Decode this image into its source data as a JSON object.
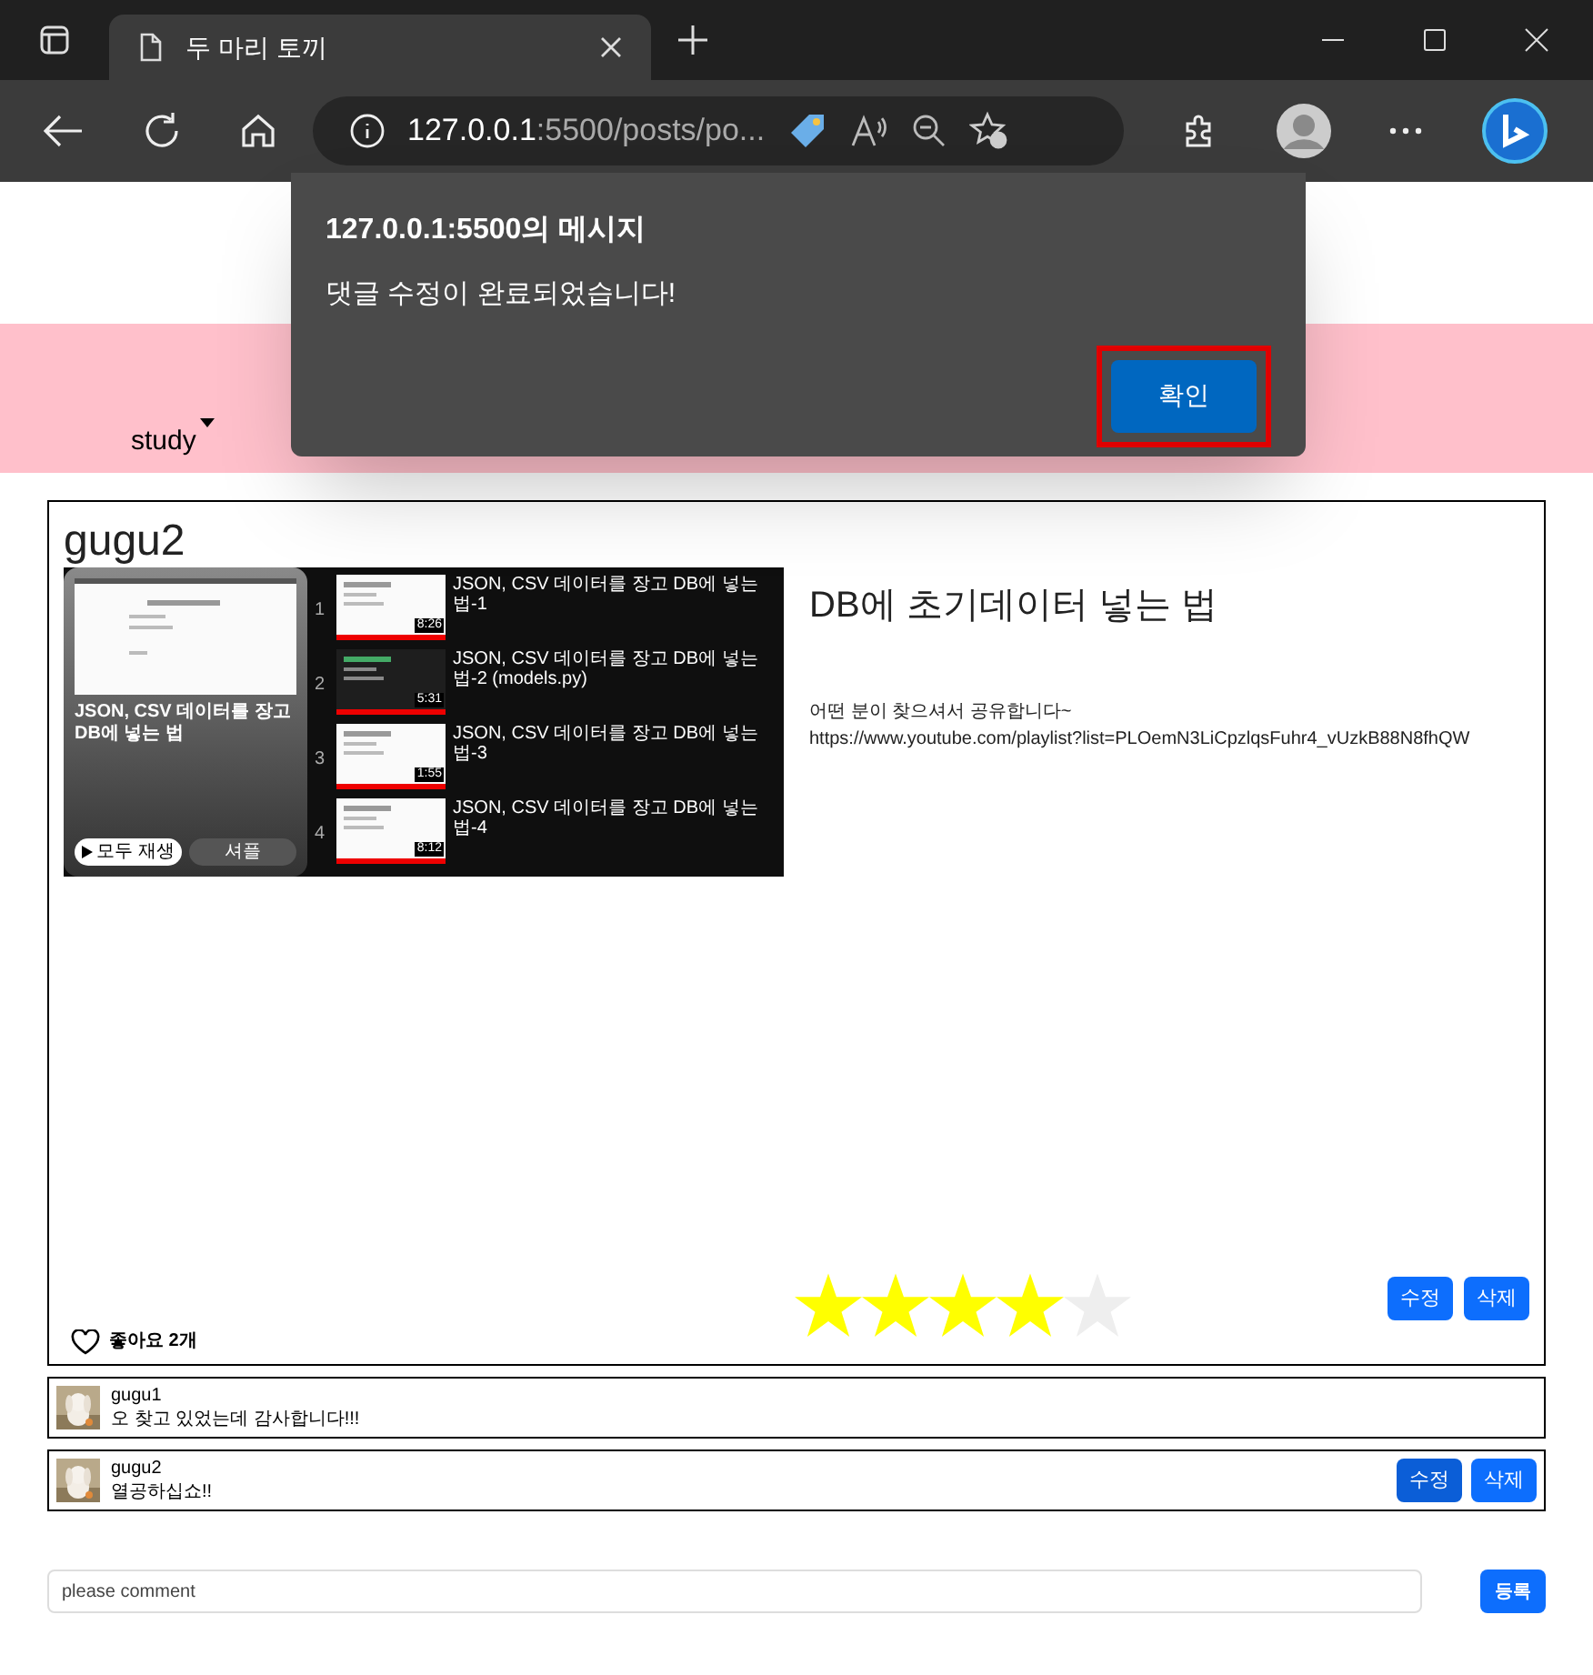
{
  "browser": {
    "tab_title": "두 마리 토끼",
    "url_host": "127.0.0.1",
    "url_rest": ":5500/posts/po..."
  },
  "dialog": {
    "title": "127.0.0.1:5500의 메시지",
    "message": "댓글 수정이 완료되었습니다!",
    "ok": "확인"
  },
  "nav": {
    "items": [
      {
        "label": "study",
        "has_dropdown": true
      }
    ]
  },
  "post": {
    "author": "gugu2",
    "title": "DB에 초기데이터 넣는 법",
    "body": "어떤 분이 찾으셔서 공유합니다~",
    "link": "https://www.youtube.com/playlist?list=PLOemN3LiCpzlqsFuhr4_vUzkB88N8fhQW",
    "screenshot": {
      "playlist_title": "JSON, CSV 데이터를 장고 DB에 넣는 법",
      "play_all": "모두 재생",
      "shuffle": "셔플",
      "videos": [
        {
          "number": "1",
          "title": "JSON, CSV 데이터를 장고 DB에 넣는 법-1",
          "duration": "8:26"
        },
        {
          "number": "2",
          "title": "JSON, CSV 데이터를 장고 DB에 넣는 법-2 (models.py)",
          "duration": "5:31"
        },
        {
          "number": "3",
          "title": "JSON, CSV 데이터를 장고 DB에 넣는 법-3",
          "duration": "1:55"
        },
        {
          "number": "4",
          "title": "JSON, CSV 데이터를 장고 DB에 넣는 법-4",
          "duration": "8:12"
        }
      ]
    },
    "stars": 4,
    "likes": "좋아요 2개",
    "edit": "수정",
    "delete": "삭제"
  },
  "comments": [
    {
      "author": "gugu1",
      "text": "오 찾고 있었는데 감사합니다!!!",
      "own": false
    },
    {
      "author": "gugu2",
      "text": "열공하십쇼!!",
      "own": true,
      "edit": "수정",
      "delete": "삭제"
    }
  ],
  "comment_form": {
    "placeholder": "please comment",
    "submit": "등록"
  }
}
